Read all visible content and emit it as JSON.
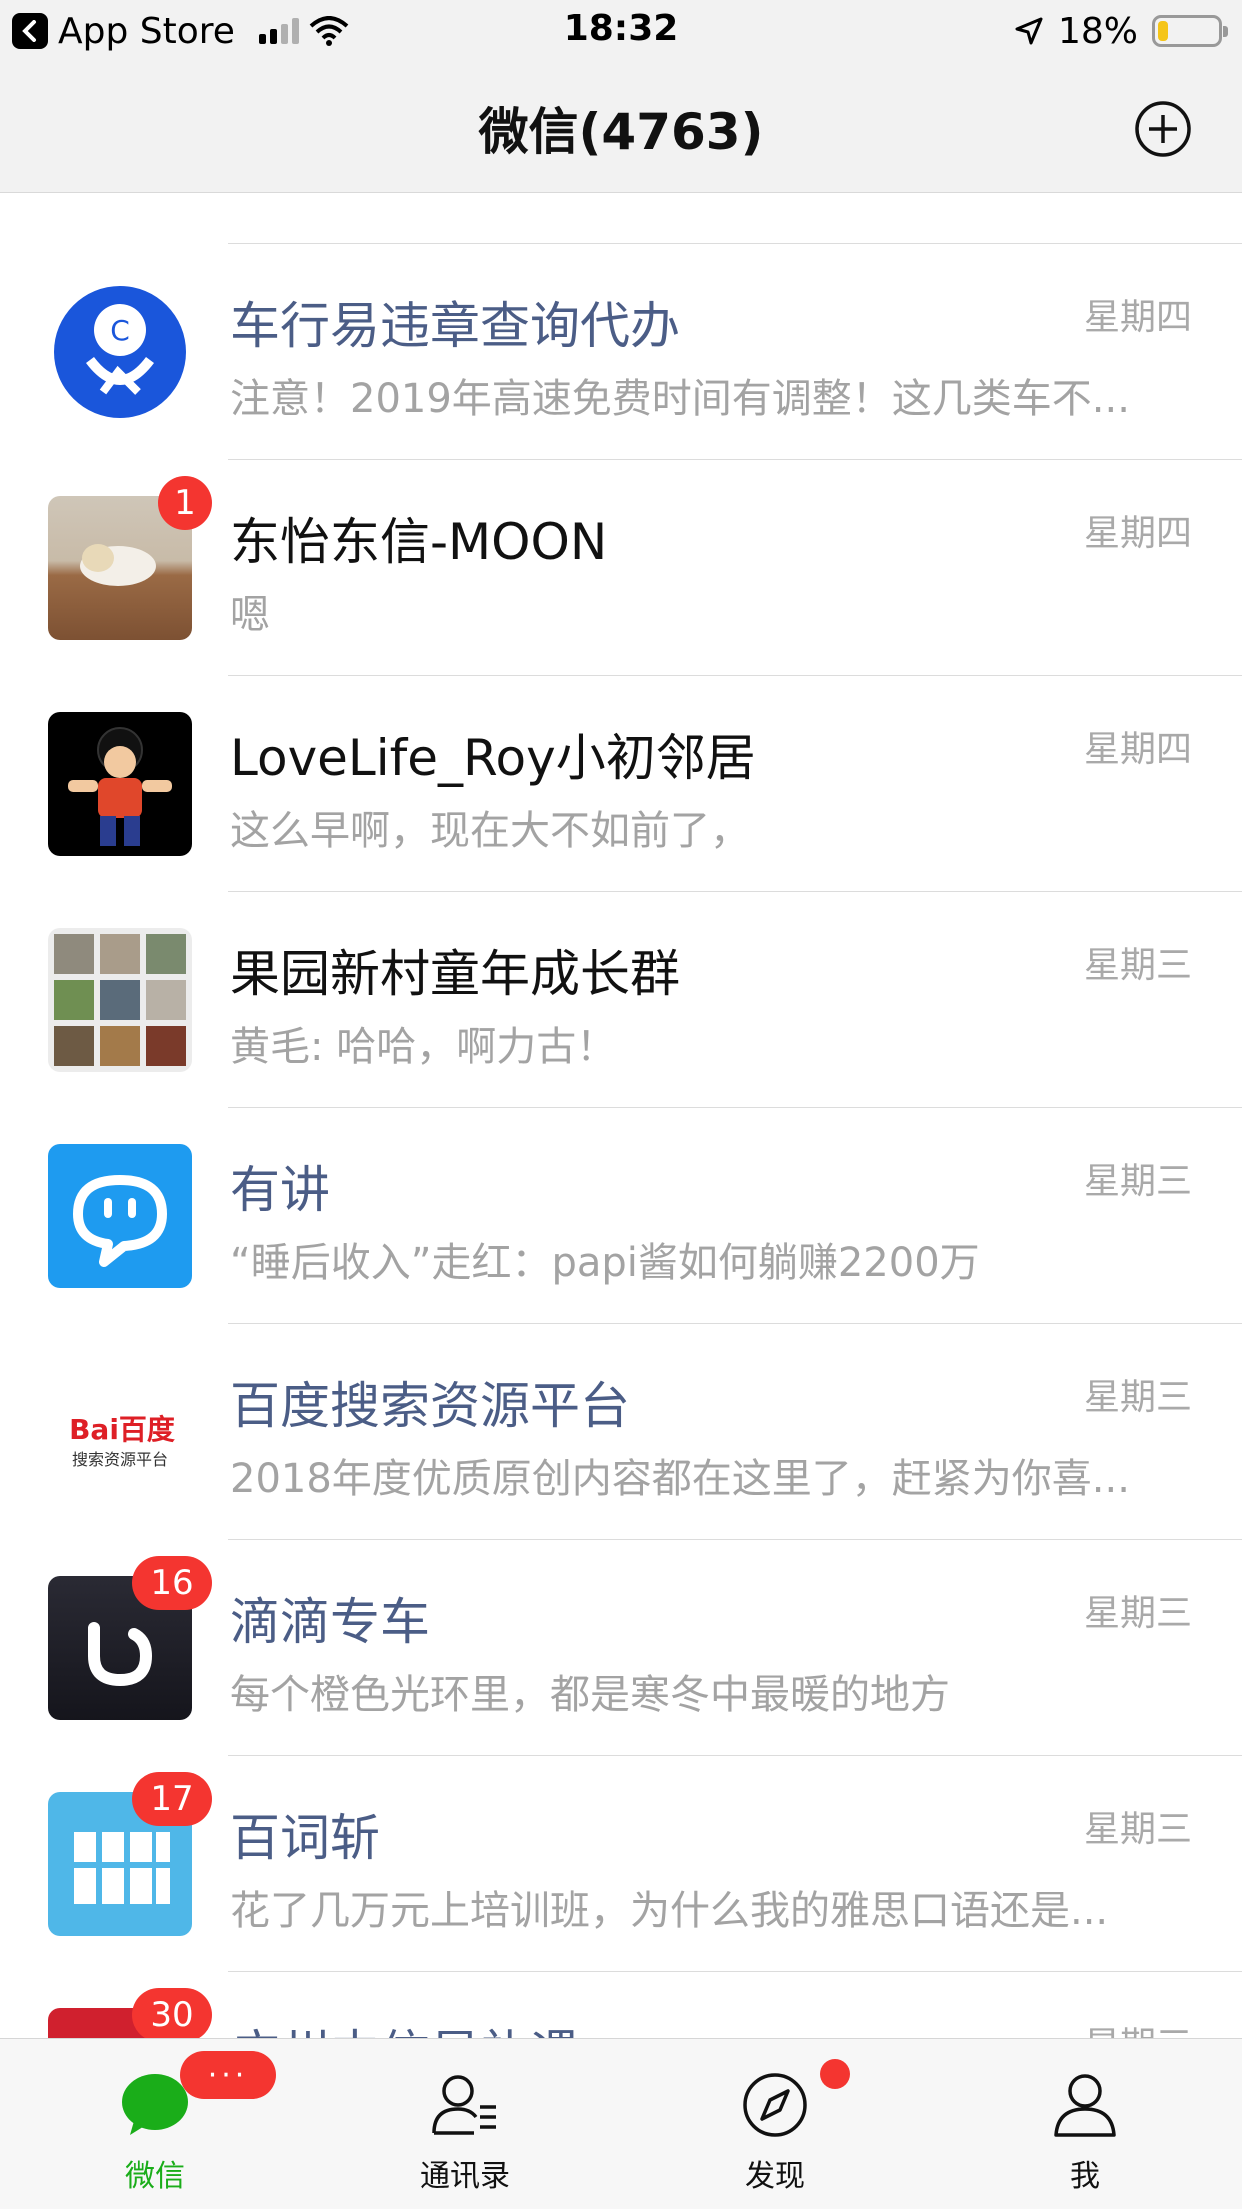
{
  "status_bar": {
    "back_app": "App Store",
    "time": "18:32",
    "battery": "18%",
    "battery_level": 0.18
  },
  "nav": {
    "title": "微信(4763)",
    "add_icon": "plus-circle-icon"
  },
  "chats": [
    {
      "name": "车行易违章查询代办",
      "official": true,
      "time": "星期四",
      "preview": "注意！2019年高速免费时间有调整！这几类车不...",
      "badge": ""
    },
    {
      "name": "东怡东信-MOON",
      "official": false,
      "time": "星期四",
      "preview": "嗯",
      "badge": "1"
    },
    {
      "name": "LoveLife_Roy小初邻居",
      "official": false,
      "time": "星期四",
      "preview": "这么早啊，现在大不如前了，",
      "badge": ""
    },
    {
      "name": "果园新村童年成长群",
      "official": false,
      "time": "星期三",
      "preview": "黄毛: 哈哈，啊力古！",
      "badge": ""
    },
    {
      "name": "有讲",
      "official": true,
      "time": "星期三",
      "preview": "“睡后收入”走红：papi酱如何躺赚2200万",
      "badge": ""
    },
    {
      "name": "百度搜索资源平台",
      "official": true,
      "time": "星期三",
      "preview": "2018年度优质原创内容都在这里了，赶紧为你喜...",
      "badge": "",
      "logo_text": "Bai百度",
      "logo_sub": "搜索资源平台"
    },
    {
      "name": "滴滴专车",
      "official": true,
      "time": "星期三",
      "preview": "每个橙色光环里，都是寒冬中最暖的地方",
      "badge": "16"
    },
    {
      "name": "百词斩",
      "official": true,
      "time": "星期三",
      "preview": "花了几万元上培训班，为什么我的雅思口语还是...",
      "badge": "17"
    },
    {
      "name": "广州中信星礼遇",
      "official": true,
      "time": "星期三",
      "preview": "",
      "badge": "30"
    }
  ],
  "tabs": [
    {
      "label": "微信",
      "icon": "chat-bubble-icon",
      "active": true,
      "badge": "···"
    },
    {
      "label": "通讯录",
      "icon": "contacts-icon",
      "active": false
    },
    {
      "label": "发现",
      "icon": "compass-icon",
      "active": false,
      "dot": true
    },
    {
      "label": "我",
      "icon": "person-icon",
      "active": false
    }
  ],
  "colors": {
    "accent": "#1aad19",
    "badge": "#f43530",
    "official_name": "#4b5d86"
  }
}
